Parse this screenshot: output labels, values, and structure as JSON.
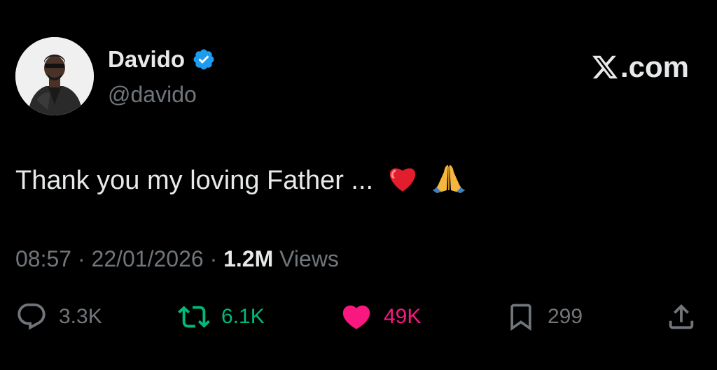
{
  "author": {
    "display_name": "Davido",
    "handle": "@davido",
    "verified": true
  },
  "brand": {
    "label": ".com",
    "logo": "x-logo-icon"
  },
  "tweet": {
    "text": "Thank you my loving Father ...",
    "emojis": [
      "red-heart-emoji",
      "folded-hands-emoji"
    ]
  },
  "meta": {
    "time": "08:57",
    "separator": "·",
    "date": "22/01/2026",
    "views_count": "1.2M",
    "views_label": "Views"
  },
  "actions": {
    "replies": "3.3K",
    "reposts": "6.1K",
    "likes": "49K",
    "bookmarks": "299"
  },
  "colors": {
    "background": "#000000",
    "text": "#e7e9ea",
    "secondary": "#71767b",
    "verified": "#1d9bf0",
    "repost": "#00ba7c",
    "like": "#f91880"
  }
}
